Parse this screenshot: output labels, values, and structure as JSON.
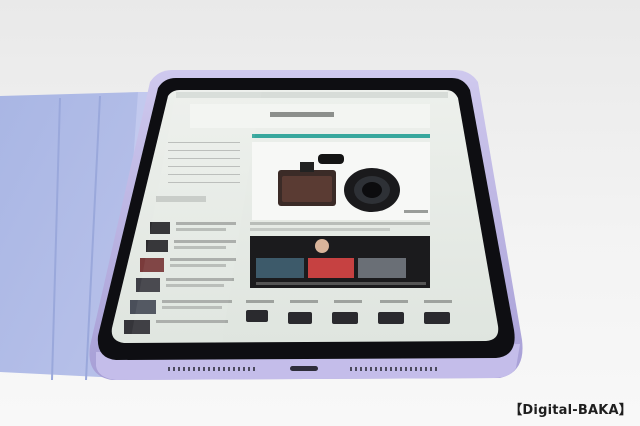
{
  "photo": {
    "subject": "tablet-with-folio-cover",
    "colors": {
      "background": "#eeeeee",
      "cover": "#aebbe6",
      "device_body": "#b9b2e0",
      "bezel": "#0e0e12",
      "screen": "#e6ebe6",
      "accent": "#37a79d"
    }
  },
  "watermark": {
    "text": "【Digital-BAKA】"
  }
}
